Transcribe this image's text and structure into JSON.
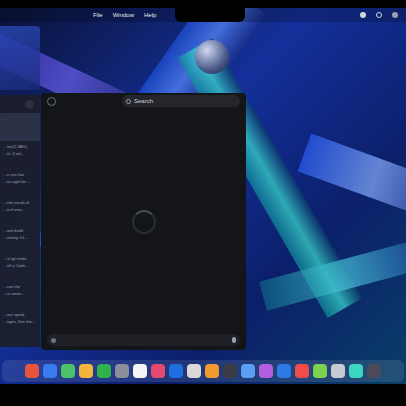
{
  "menubar": {
    "items": [
      {
        "label": "File"
      },
      {
        "label": "Window"
      },
      {
        "label": "Help"
      }
    ]
  },
  "chat_window": {
    "search": {
      "placeholder": "Search"
    },
    "loading": true
  },
  "sidebar": {
    "items": [
      {
        "lines": [
          "…"
        ],
        "selected": true
      },
      {
        "lines": [
          "…tes(2-3A%)",
          "…nl -3 wil…"
        ],
        "selected": false
      },
      {
        "lines": [
          "…n  von has",
          "…ou agnt for…"
        ],
        "selected": false
      },
      {
        "lines": [
          "…nlin sncds of",
          "…ncil vrns…"
        ],
        "selected": false
      },
      {
        "lines": [
          "…wnt bsdd",
          "…amnty: h1…"
        ],
        "selected": false
      },
      {
        "lines": [
          "…vt tgl rsnds",
          "…otl a Cnds…"
        ],
        "selected": false
      },
      {
        "lines": [
          "…con the",
          "…ur wnse…"
        ],
        "selected": false
      },
      {
        "lines": [
          "…our speak",
          "…nges, Drw the…"
        ],
        "selected": false
      }
    ]
  },
  "dock": {
    "apps": [
      {
        "color": "#e8553d"
      },
      {
        "color": "#3a7bf0"
      },
      {
        "color": "#4cc36b"
      },
      {
        "color": "#f2b63a"
      },
      {
        "color": "#2fb24c"
      },
      {
        "color": "#8a8f99"
      },
      {
        "color": "#f4f4f4"
      },
      {
        "color": "#e44a6f"
      },
      {
        "color": "#1e6fe0"
      },
      {
        "color": "#d9d9d9"
      },
      {
        "color": "#f29a2e"
      },
      {
        "color": "#3c3c46"
      },
      {
        "color": "#5aa0f2"
      },
      {
        "color": "#b45de0"
      },
      {
        "color": "#2c7be5"
      },
      {
        "color": "#f24b4b"
      },
      {
        "color": "#7bd34f"
      },
      {
        "color": "#c9c9d1"
      },
      {
        "color": "#3dd6c0"
      },
      {
        "color": "#4a4a58"
      }
    ]
  }
}
